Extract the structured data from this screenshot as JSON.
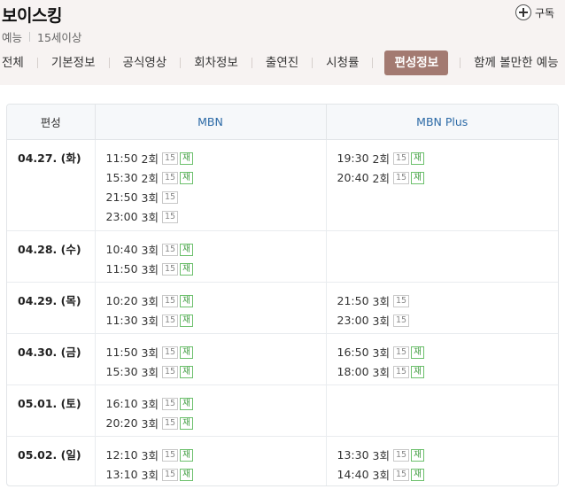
{
  "program": {
    "title": "보이스킹",
    "genre": "예능",
    "rating": "15세이상",
    "subscribe_label": "구독"
  },
  "tabs": [
    {
      "label": "전체",
      "active": false
    },
    {
      "label": "기본정보",
      "active": false
    },
    {
      "label": "공식영상",
      "active": false
    },
    {
      "label": "회차정보",
      "active": false
    },
    {
      "label": "출연진",
      "active": false
    },
    {
      "label": "시청률",
      "active": false
    },
    {
      "label": "편성정보",
      "active": true
    },
    {
      "label": "함께 볼만한 예능",
      "active": false
    }
  ],
  "schedule": {
    "headers": {
      "day": "편성",
      "mbn": "MBN",
      "plus": "MBN Plus"
    },
    "rows": [
      {
        "day": "04.27. (화)",
        "mbn": [
          {
            "time": "11:50",
            "ep": "2회",
            "age": "15",
            "re": "재"
          },
          {
            "time": "15:30",
            "ep": "2회",
            "age": "15",
            "re": "재"
          },
          {
            "time": "21:50",
            "ep": "3회",
            "age": "15",
            "re": ""
          },
          {
            "time": "23:00",
            "ep": "3회",
            "age": "15",
            "re": ""
          }
        ],
        "plus": [
          {
            "time": "19:30",
            "ep": "2회",
            "age": "15",
            "re": "재"
          },
          {
            "time": "20:40",
            "ep": "2회",
            "age": "15",
            "re": "재"
          }
        ]
      },
      {
        "day": "04.28. (수)",
        "mbn": [
          {
            "time": "10:40",
            "ep": "3회",
            "age": "15",
            "re": "재"
          },
          {
            "time": "11:50",
            "ep": "3회",
            "age": "15",
            "re": "재"
          }
        ],
        "plus": []
      },
      {
        "day": "04.29. (목)",
        "mbn": [
          {
            "time": "10:20",
            "ep": "3회",
            "age": "15",
            "re": "재"
          },
          {
            "time": "11:30",
            "ep": "3회",
            "age": "15",
            "re": "재"
          }
        ],
        "plus": [
          {
            "time": "21:50",
            "ep": "3회",
            "age": "15",
            "re": ""
          },
          {
            "time": "23:00",
            "ep": "3회",
            "age": "15",
            "re": ""
          }
        ]
      },
      {
        "day": "04.30. (금)",
        "mbn": [
          {
            "time": "11:50",
            "ep": "3회",
            "age": "15",
            "re": "재"
          },
          {
            "time": "15:30",
            "ep": "3회",
            "age": "15",
            "re": "재"
          }
        ],
        "plus": [
          {
            "time": "16:50",
            "ep": "3회",
            "age": "15",
            "re": "재"
          },
          {
            "time": "18:00",
            "ep": "3회",
            "age": "15",
            "re": "재"
          }
        ]
      },
      {
        "day": "05.01. (토)",
        "mbn": [
          {
            "time": "16:10",
            "ep": "3회",
            "age": "15",
            "re": "재"
          },
          {
            "time": "20:20",
            "ep": "3회",
            "age": "15",
            "re": "재"
          }
        ],
        "plus": []
      },
      {
        "day": "05.02. (일)",
        "mbn": [
          {
            "time": "12:10",
            "ep": "3회",
            "age": "15",
            "re": "재"
          },
          {
            "time": "13:10",
            "ep": "3회",
            "age": "15",
            "re": "재"
          }
        ],
        "plus": [
          {
            "time": "13:30",
            "ep": "3회",
            "age": "15",
            "re": "재"
          },
          {
            "time": "14:40",
            "ep": "3회",
            "age": "15",
            "re": "재"
          }
        ]
      }
    ]
  }
}
